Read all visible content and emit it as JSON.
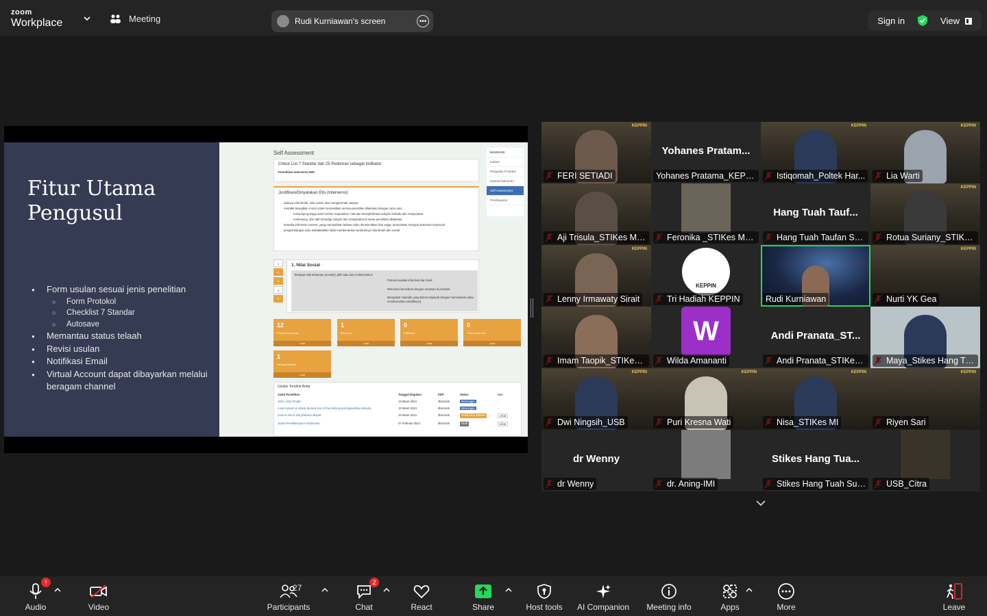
{
  "app": {
    "brand_top": "zoom",
    "brand_bottom": "Workplace",
    "meeting_label": "Meeting",
    "share_title": "Rudi Kurniawan's screen",
    "sign_in": "Sign in",
    "view": "View"
  },
  "slide": {
    "title_line1": "Fitur Utama",
    "title_line2": "Pengusul",
    "bullets": [
      "Form usulan sesuai jenis penelitian",
      "Form Protokol",
      "Checklist 7 Standar",
      "Autosave",
      "Memantau status telaah",
      "Revisi usulan",
      "Notifikasi Email",
      "Virtual Account dapat dibayarkan melalui beragam channel"
    ],
    "app_title": "Self Assessment",
    "checklist_heading": "Check List 7 Standar dan 25 Pedoman sebagai Indikator:",
    "checklist_sub": "Penelitian Intervensi IND",
    "justifikasi": "Justifikasi/Dinyatakan Etis (Intervensi):",
    "justifikasi_items": [
      "adanya nilai ilmiah, nilai sosial, dan menghormati subyek.",
      "memiliki kewajiban moral untuk memastikan semua penelitian dilakukan dengan cara-cara:",
      "menjunjung tinggi rasa hormat, kepedulian, hak dan kesejahteraan subyek individu dan masyarakat",
      "melindungi, dan adil terhadap subyek dan masyarakat di mana penelitian dilakukan.",
      "tersedia informed consent, yang memastikan bahwa risiko diminimalkan dan wajar, penyuratan merujuk pedoman terpenuhi.",
      "pengembangan atau ketidakadilan tidak membenarkan tumbuhnya nilai ilmiah dan sosial."
    ],
    "nilai_sosial": "1. Nilai Sosial",
    "nilai_question": "Terdapat nilai kebaruan (novelty): pilih satu dari 3 sifat berikut:",
    "nilai_options": [
      "Potensi kualitas informasi dan hasil",
      "Relevansi bermakna dengan rumusan di protokol",
      "Mengatasi masalah yang belum terjawab dengan memuaskan (atau membenarkan sebaliknya)"
    ],
    "steps": [
      "1",
      "2",
      "3",
      "4",
      "5"
    ],
    "nav_title": "NAVIGASI",
    "nav_items": [
      "Inisiasi",
      "Pengisian Protokol",
      "Upload Dokumen",
      "Self Assessment",
      "Pembayaran"
    ],
    "stat_tiles": [
      {
        "value": "12",
        "label": "Protokol Diusulkan",
        "link": "Lihat"
      },
      {
        "value": "1",
        "label": "Exempted",
        "link": "Lihat"
      },
      {
        "value": "0",
        "label": "Fullboard",
        "link": "Lihat"
      },
      {
        "value": "0",
        "label": "Tidak Layak Etik",
        "link": "Lihat"
      },
      {
        "value": "1",
        "label": "Sedang Ditelaah",
        "link": "Lihat"
      }
    ],
    "usulan_title": "Usulan Terakhir Anda",
    "usulan_headers": [
      "Judul Penelitian",
      "Tanggal diajukan",
      "KEP",
      "Status",
      "Act."
    ],
    "usulan_rows": [
      [
        "JOS LANG RAMU",
        "19 Maret 2024",
        "dbscrank",
        "Menunggu",
        "-"
      ],
      [
        "Lorem Ipsum is simply dummy text of the printing and typesetting industry.",
        "19 Maret 2024",
        "dbscrank",
        "Menunggu",
        "-"
      ],
      [
        "Cras et nisi et nisi pharetra aliquet.",
        "19 Maret 2024",
        "dbscrank",
        "Tidak lulus diakses",
        "Lihat"
      ],
      [
        "Judul Penelitiannya ini Indonesia",
        "07 Februari 2024",
        "dbscrank",
        "Draft",
        "Lihat"
      ]
    ]
  },
  "participants": [
    {
      "name": "FERI SETIADI",
      "big": ""
    },
    {
      "name": "Yohanes Pratama_KEPPIN",
      "big": "Yohanes Pratam..."
    },
    {
      "name": "Istiqomah_Poltek Har...",
      "big": ""
    },
    {
      "name": "Lia Warti",
      "big": ""
    },
    {
      "name": "Aji Trisula_STIKes Me...",
      "big": ""
    },
    {
      "name": "Feronika _STIKes Me...",
      "big": ""
    },
    {
      "name": "Hang Tuah Taufan Su...",
      "big": "Hang Tuah Tauf..."
    },
    {
      "name": "Rotua Suriany_STIKes...",
      "big": ""
    },
    {
      "name": "Lenny Irmawaty Sirait",
      "big": ""
    },
    {
      "name": "Tri Hadiah KEPPIN",
      "big": ""
    },
    {
      "name": "Rudi Kurniawan",
      "big": ""
    },
    {
      "name": "Nurti YK Gea",
      "big": ""
    },
    {
      "name": "Imam Taopik_STIKes ...",
      "big": ""
    },
    {
      "name": "Wilda Amananti",
      "big": ""
    },
    {
      "name": "Andi Pranata_STIKes ...",
      "big": "Andi  Pranata_ST..."
    },
    {
      "name": "Maya_Stikes Hang Tu...",
      "big": ""
    },
    {
      "name": "Dwi Ningsih_USB",
      "big": ""
    },
    {
      "name": "Puri Kresna Wati",
      "big": ""
    },
    {
      "name": "Nisa_STIKes MI",
      "big": ""
    },
    {
      "name": "Riyen Sari",
      "big": ""
    },
    {
      "name": "dr Wenny",
      "big": "dr Wenny"
    },
    {
      "name": "dr. Aning-IMI",
      "big": ""
    },
    {
      "name": "Stikes Hang Tuah Sur...",
      "big": "Stikes Hang Tua..."
    },
    {
      "name": "USB_Citra",
      "big": ""
    }
  ],
  "overlay_text": {
    "banner": "KEPPIN",
    "wilda_avatar": "W",
    "tri_logo": "KEPPIN"
  },
  "toolbar": {
    "audio": "Audio",
    "audio_badge": "!",
    "video": "Video",
    "participants": "Participants",
    "participants_count": "27",
    "chat": "Chat",
    "chat_badge": "2",
    "react": "React",
    "share": "Share",
    "host_tools": "Host tools",
    "ai_companion": "AI Companion",
    "meeting_info": "Meeting info",
    "apps": "Apps",
    "more": "More",
    "leave": "Leave"
  },
  "colors": {
    "share_green": "#23d959",
    "leave_red": "#e02b2b",
    "slide_navy": "#363b54",
    "tile_orange": "#e8a23f",
    "active_speaker": "#23d959"
  }
}
